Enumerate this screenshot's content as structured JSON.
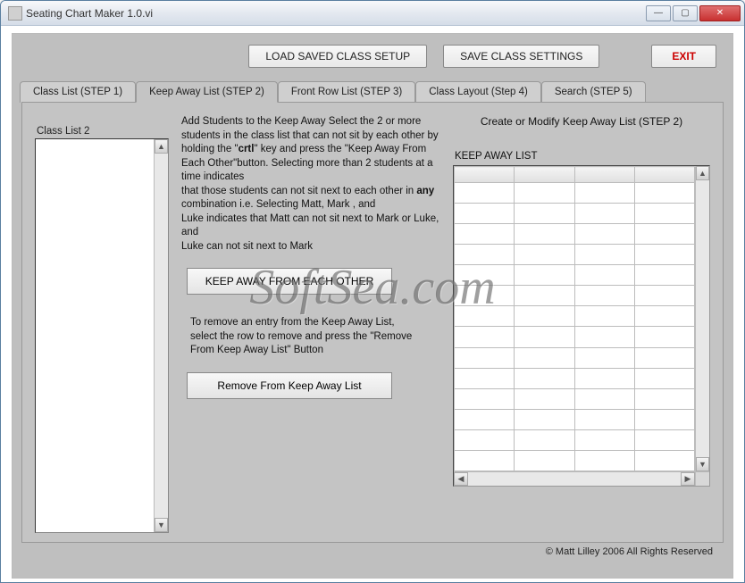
{
  "window": {
    "title": "Seating Chart Maker 1.0.vi"
  },
  "topbar": {
    "load_label": "LOAD SAVED CLASS SETUP",
    "save_label": "SAVE CLASS SETTINGS",
    "exit_label": "EXIT"
  },
  "tabs": {
    "t1": "Class List (STEP 1)",
    "t2": "Keep Away List (STEP 2)",
    "t3": "Front Row List (STEP 3)",
    "t4": "Class Layout (Step 4)",
    "t5": "Search (STEP 5)",
    "active": "t2"
  },
  "left": {
    "label": "Class List 2"
  },
  "mid": {
    "para1a": "Add Students to  the Keep Away Select the 2 or more students in the class list that can not  sit by each other by holding the \"",
    "para1b_bold": "crtl",
    "para1c": "\" key and press the \"Keep Away From Each Other\"button. Selecting more than 2 students at a time indicates",
    "para2a": "that those students can not sit next to each other in ",
    "para2b_bold": "any",
    "para2c": " combination i.e. Selecting Matt, Mark , and",
    "para3": " Luke indicates that Matt can not sit next to Mark or Luke, and",
    "para4": "Luke can not sit next to Mark",
    "keepaway_btn": "KEEP AWAY FROM EACH OTHER",
    "remove_note": "To remove an entry from the Keep Away List, select the row to remove and press the \"Remove From Keep Away List\" Button",
    "remove_btn": "Remove From Keep Away List"
  },
  "right": {
    "title": "Create or Modify Keep Away List (STEP 2)",
    "grid_label": "KEEP AWAY LIST",
    "columns": 4,
    "rows": 14
  },
  "footer": {
    "copyright": "© Matt Lilley 2006 All Rights Reserved"
  },
  "watermark": "SoftSea.com"
}
